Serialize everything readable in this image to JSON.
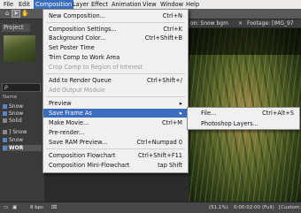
{
  "menubar": {
    "items": [
      "File",
      "Edit",
      "Composition",
      "Layer",
      "Effect",
      "Animation",
      "View",
      "Window",
      "Help"
    ]
  },
  "left_panel": {
    "project_tab": "Project",
    "search_symbol": "ρ",
    "name_col": "Name",
    "items": [
      "Snow",
      "Snow",
      "Solid",
      "] Snow",
      "Snow",
      "WOR"
    ]
  },
  "comp_panel": {
    "tab_prefix": "on: Snow bgm",
    "tab_close": "×",
    "tab_second": "Footage: [IMG_97"
  },
  "menu": {
    "items": [
      {
        "label": "New Composition...",
        "shortcut": "Ctrl+N",
        "enabled": true
      },
      {
        "label": "Composition Settings...",
        "shortcut": "Ctrl+K",
        "enabled": true
      },
      {
        "label": "Background Color...",
        "shortcut": "Ctrl+Shift+B",
        "enabled": true
      },
      {
        "label": "Set Poster Time",
        "shortcut": "",
        "enabled": true
      },
      {
        "label": "Trim Comp to Work Area",
        "shortcut": "",
        "enabled": true
      },
      {
        "label": "Crop Comp to Region of Interest",
        "shortcut": "",
        "enabled": false
      },
      {
        "label": "Add to Render Queue",
        "shortcut": "Ctrl+Shift+/",
        "enabled": true
      },
      {
        "label": "Add Output Module",
        "shortcut": "",
        "enabled": false
      },
      {
        "label": "Preview",
        "shortcut": "",
        "enabled": true,
        "submenu": true
      },
      {
        "label": "Save Frame As",
        "shortcut": "",
        "enabled": true,
        "submenu": true,
        "highlighted": true
      },
      {
        "label": "Make Movie...",
        "shortcut": "Ctrl+M",
        "enabled": true
      },
      {
        "label": "Pre-render...",
        "shortcut": "",
        "enabled": true
      },
      {
        "label": "Save RAM Preview...",
        "shortcut": "Ctrl+Numpad 0",
        "enabled": true
      },
      {
        "label": "Composition Flowchart",
        "shortcut": "Ctrl+Shift+F11",
        "enabled": true
      },
      {
        "label": "Composition Mini-Flowchart",
        "shortcut": "tap Shift",
        "enabled": true
      }
    ]
  },
  "submenu": {
    "items": [
      {
        "label": "File...",
        "shortcut": "Ctrl+Alt+S"
      },
      {
        "label": "Photoshop Layers...",
        "shortcut": ""
      }
    ]
  },
  "statusbar": {
    "bpc": "8 bpc",
    "zoom": "(51.1%)",
    "timecode": "0:00:02:00",
    "view": "(Full)",
    "custom": "[Custom..."
  },
  "colors": {
    "highlight": "#3b6dbf",
    "menu_bg": "#f0f0f0"
  }
}
